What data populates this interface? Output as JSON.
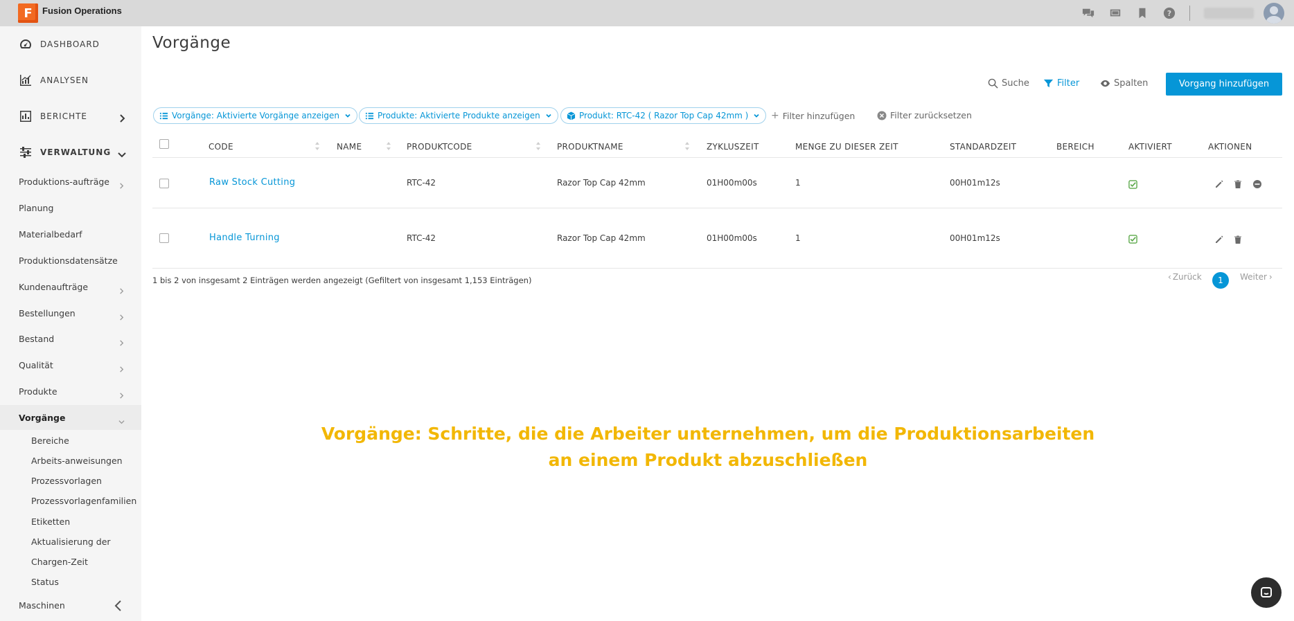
{
  "app": {
    "title": "Fusion Operations",
    "logo_letter": "F",
    "accent": "#0696d7",
    "brand": "#f26a21"
  },
  "topbar": {
    "icons": [
      "chat-icon",
      "screen-icon",
      "bookmark-icon",
      "help-icon"
    ]
  },
  "sidebar": {
    "main": [
      {
        "label": "DASHBOARD",
        "icon": "gauge-icon"
      },
      {
        "label": "ANALYSEN",
        "icon": "chart-icon"
      },
      {
        "label": "BERICHTE",
        "icon": "report-icon"
      },
      {
        "label": "VERWALTUNG",
        "icon": "sliders-icon"
      }
    ],
    "sub": [
      {
        "label": "Produktions-aufträge"
      },
      {
        "label": "Planung"
      },
      {
        "label": "Materialbedarf"
      },
      {
        "label": "Produktionsdatensätze"
      },
      {
        "label": "Kundenaufträge"
      },
      {
        "label": "Bestellungen"
      },
      {
        "label": "Bestand"
      },
      {
        "label": "Qualität"
      },
      {
        "label": "Produkte"
      },
      {
        "label": "Vorgänge"
      }
    ],
    "leaves": [
      {
        "label": "Bereiche"
      },
      {
        "label": "Arbeits-anweisungen"
      },
      {
        "label": "Prozessvorlagen"
      },
      {
        "label": "Prozessvorlagenfamilien"
      },
      {
        "label": "Etiketten"
      },
      {
        "label": "Aktualisierung der"
      },
      {
        "label": "Chargen-Zeit"
      },
      {
        "label": "Status"
      }
    ],
    "bottom": {
      "label": "Maschinen"
    }
  },
  "main": {
    "title": "Vorgänge",
    "toolbar": {
      "search": "Suche",
      "filter": "Filter",
      "columns": "Spalten",
      "add": "Vorgang hinzufügen"
    },
    "filters": {
      "chip1": "Vorgänge: Aktivierte Vorgänge anzeigen",
      "chip2": "Produkte: Aktivierte Produkte anzeigen",
      "chip3": "Produkt: RTC-42 ( Razor Top Cap 42mm )",
      "add_filter": "Filter hinzufügen",
      "reset": "Filter zurücksetzen"
    },
    "columns": [
      "CODE",
      "NAME",
      "PRODUKTCODE",
      "PRODUKTNAME",
      "ZYKLUSZEIT",
      "MENGE ZU DIESER ZEIT",
      "STANDARDZEIT",
      "BEREICH",
      "AKTIVIERT",
      "AKTIONEN"
    ],
    "rows": [
      {
        "code": "Raw Stock Cutting",
        "name": "",
        "product_code": "RTC-42",
        "product_name": "Razor Top Cap 42mm",
        "cycle_time": "01H00m00s",
        "qty": "1",
        "std_time": "00H01m12s",
        "area": "",
        "activated": true
      },
      {
        "code": "Handle Turning",
        "name": "",
        "product_code": "RTC-42",
        "product_name": "Razor Top Cap 42mm",
        "cycle_time": "01H00m00s",
        "qty": "1",
        "std_time": "00H01m12s",
        "area": "",
        "activated": true
      }
    ],
    "info": "1 bis 2 von insgesamt 2 Einträgen werden angezeigt (Gefiltert von insgesamt 1,153 Einträgen)",
    "pager": {
      "prev": "Zurück",
      "current": "1",
      "next": "Weiter"
    }
  },
  "caption": {
    "line1": "Vorgänge: Schritte, die die Arbeiter unternehmen, um die Produktionsarbeiten",
    "line2": "an einem Produkt abzuschließen",
    "color": "#f2b705"
  }
}
